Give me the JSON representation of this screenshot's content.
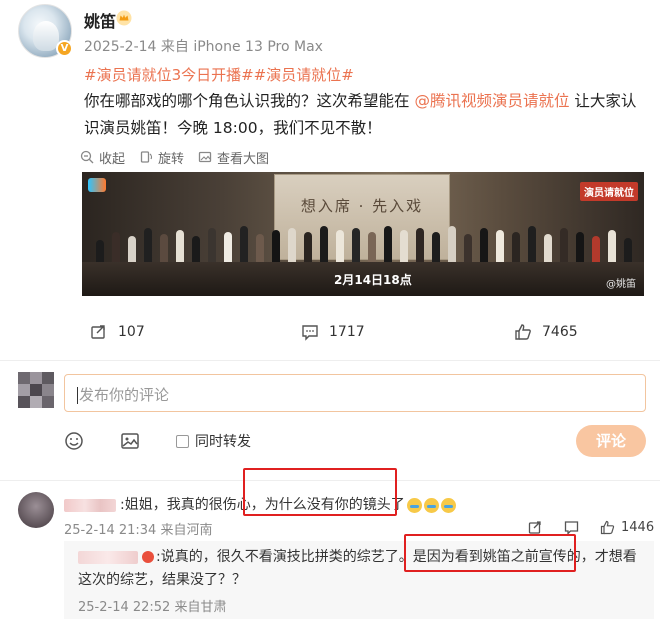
{
  "post": {
    "author": "姚笛",
    "meta": "2025-2-14  来自 iPhone 13 Pro Max",
    "hashtags": "#演员请就位3今日开播##演员请就位#",
    "content_before": "你在哪部戏的哪个角色认识我的？这次希望能在 ",
    "mention": "@腾讯视频演员请就位",
    "content_after": " 让大家认识演员姚笛！今晚 18:00，我们不见不散！",
    "media_actions": {
      "collect": "收起",
      "rotate": "旋转",
      "view_large": "查看大图"
    },
    "poster": {
      "screen_title": "想入席 · 先入戏",
      "date_text": "2月14日18点",
      "logo_right": "演员请就位",
      "watermark": "@姚笛"
    },
    "stats": {
      "reposts": "107",
      "comments": "1717",
      "likes": "7465"
    }
  },
  "composer": {
    "placeholder": "发布你的评论",
    "repost_label": "同时转发",
    "submit_label": "评论"
  },
  "comment1": {
    "text_prefix": ":姐姐，我真的很伤心，",
    "text_highlight": "为什么没有你的镜头了",
    "meta": "25-2-14 21:34 来自河南",
    "likes": "1446"
  },
  "reply1": {
    "text_prefix": ":说真的，很久不看演技比拼类的综艺了。",
    "text_highlight": "是因为看到姚笛之前宣传的",
    "text_suffix": "，才想看这次的综艺，结果没了？？",
    "meta": "25-2-14 22:52 来自甘肃"
  },
  "colors": {
    "accent": "#eb7350",
    "highlight_border": "#e02020",
    "button_disabled": "#f9c6a1"
  }
}
